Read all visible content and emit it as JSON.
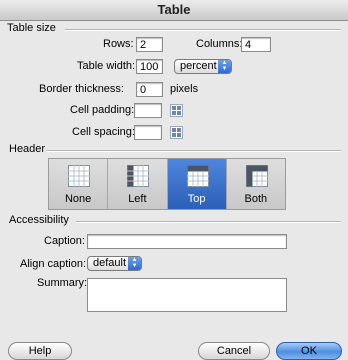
{
  "window": {
    "title": "Table"
  },
  "table_size": {
    "section_label": "Table size",
    "rows_label": "Rows:",
    "rows_value": "2",
    "columns_label": "Columns:",
    "columns_value": "4",
    "width_label": "Table width:",
    "width_value": "100",
    "width_unit": "percent",
    "border_label": "Border thickness:",
    "border_value": "0",
    "border_unit": "pixels",
    "padding_label": "Cell padding:",
    "padding_value": "",
    "spacing_label": "Cell spacing:",
    "spacing_value": ""
  },
  "header": {
    "section_label": "Header",
    "options": [
      {
        "label": "None",
        "icon": "table-header-none-icon"
      },
      {
        "label": "Left",
        "icon": "table-header-left-icon"
      },
      {
        "label": "Top",
        "icon": "table-header-top-icon"
      },
      {
        "label": "Both",
        "icon": "table-header-both-icon"
      }
    ],
    "selected": "Top"
  },
  "accessibility": {
    "section_label": "Accessibility",
    "caption_label": "Caption:",
    "caption_value": "",
    "align_label": "Align caption:",
    "align_value": "default",
    "summary_label": "Summary:",
    "summary_value": ""
  },
  "buttons": {
    "help": "Help",
    "cancel": "Cancel",
    "ok": "OK"
  },
  "colors": {
    "selected_segment": "#3a6fca",
    "default_button": "#5b9ae5"
  }
}
